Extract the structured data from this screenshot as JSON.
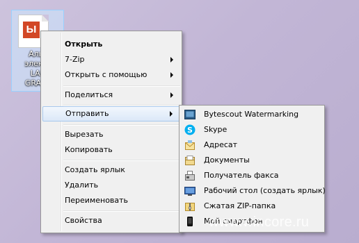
{
  "desktop_icon": {
    "label_lines": [
      "Альб",
      "электр",
      "LAD",
      "GRANT"
    ]
  },
  "context_menu": {
    "items": [
      {
        "label": "Открыть"
      },
      {
        "label": "7-Zip"
      },
      {
        "label": "Открыть с помощью"
      },
      {
        "label": "Поделиться"
      },
      {
        "label": "Отправить"
      },
      {
        "label": "Вырезать"
      },
      {
        "label": "Копировать"
      },
      {
        "label": "Создать ярлык"
      },
      {
        "label": "Удалить"
      },
      {
        "label": "Переименовать"
      },
      {
        "label": "Свойства"
      }
    ]
  },
  "send_to_menu": {
    "items": [
      {
        "label": "Bytescout Watermarking",
        "icon": "bytescout-icon"
      },
      {
        "label": "Skype",
        "icon": "skype-icon"
      },
      {
        "label": "Адресат",
        "icon": "mail-recipient-icon"
      },
      {
        "label": "Документы",
        "icon": "documents-icon"
      },
      {
        "label": "Получатель факса",
        "icon": "fax-icon"
      },
      {
        "label": "Рабочий стол (создать ярлык)",
        "icon": "desktop-icon"
      },
      {
        "label": "Сжатая ZIP-папка",
        "icon": "zip-folder-icon"
      },
      {
        "label": "Мой смартфон",
        "icon": "smartphone-icon"
      }
    ]
  },
  "watermark": "www.wincore.ru",
  "colors": {
    "desktop": "#c2b6d6",
    "menu_bg": "#f0f0f0",
    "hover_border": "#a8c8ec",
    "file_logo": "#d24726"
  }
}
